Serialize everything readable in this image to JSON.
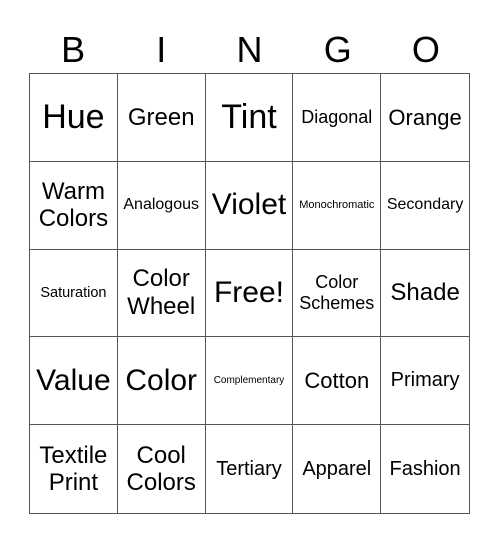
{
  "header": [
    "B",
    "I",
    "N",
    "G",
    "O"
  ],
  "cells": [
    "Hue",
    "Green",
    "Tint",
    "Diagonal",
    "Orange",
    "Warm Colors",
    "Analogous",
    "Violet",
    "Monochromatic",
    "Secondary",
    "Saturation",
    "Color Wheel",
    "Free!",
    "Color Schemes",
    "Shade",
    "Value",
    "Color",
    "Complementary",
    "Cotton",
    "Primary",
    "Textile Print",
    "Cool Colors",
    "Tertiary",
    "Apparel",
    "Fashion"
  ]
}
